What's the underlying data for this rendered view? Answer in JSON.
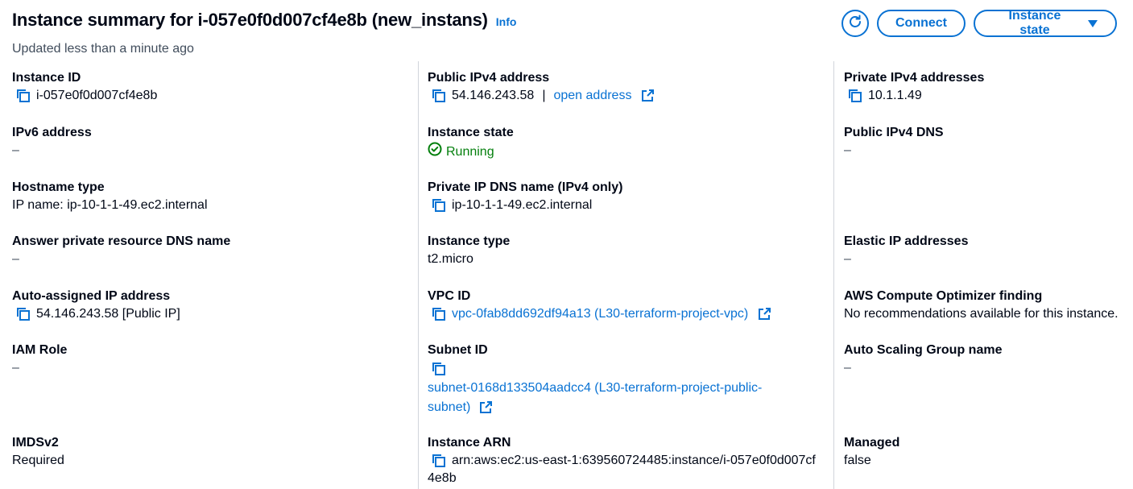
{
  "header": {
    "title": "Instance summary for i-057e0f0d007cf4e8b (new_instans)",
    "info": "Info",
    "subtitle": "Updated less than a minute ago",
    "connect": "Connect",
    "instance_state": "Instance state"
  },
  "col1": {
    "instance_id_label": "Instance ID",
    "instance_id": "i-057e0f0d007cf4e8b",
    "ipv6_label": "IPv6 address",
    "ipv6": "–",
    "hostname_type_label": "Hostname type",
    "hostname_type": "IP name: ip-10-1-1-49.ec2.internal",
    "answer_dns_label": "Answer private resource DNS name",
    "answer_dns": "–",
    "auto_ip_label": "Auto-assigned IP address",
    "auto_ip": "54.146.243.58 [Public IP]",
    "iam_label": "IAM Role",
    "iam": "–",
    "imds_label": "IMDSv2",
    "imds": "Required"
  },
  "col2": {
    "public_ipv4_label": "Public IPv4 address",
    "public_ipv4": "54.146.243.58",
    "separator": "|",
    "open_address": "open address",
    "state_label": "Instance state",
    "state": "Running",
    "private_dns_label": "Private IP DNS name (IPv4 only)",
    "private_dns": "ip-10-1-1-49.ec2.internal",
    "type_label": "Instance type",
    "type": "t2.micro",
    "vpc_label": "VPC ID",
    "vpc": "vpc-0fab8dd692df94a13 (L30-terraform-project-vpc)",
    "subnet_label": "Subnet ID",
    "subnet_line1": "subnet-0168d133504aadcc4 (L30-terraform-project-public-",
    "subnet_line2": "subnet)",
    "arn_label": "Instance ARN",
    "arn_line1": "arn:aws:ec2:us-east-1:639560724485:instance/i-057e0f0d007cf",
    "arn_line2": "4e8b"
  },
  "col3": {
    "private_ipv4_label": "Private IPv4 addresses",
    "private_ipv4": "10.1.1.49",
    "public_dns_label": "Public IPv4 DNS",
    "public_dns": "–",
    "elastic_label": "Elastic IP addresses",
    "elastic": "–",
    "optimizer_label": "AWS Compute Optimizer finding",
    "optimizer": "No recommendations available for this instance.",
    "asg_label": "Auto Scaling Group name",
    "asg": "–",
    "managed_label": "Managed",
    "managed": "false"
  },
  "icons": {
    "refresh": "refresh-icon",
    "copy": "copy-icon",
    "external": "external-link-icon",
    "status": "status-success-icon",
    "caret": "caret-down-icon"
  },
  "colors": {
    "accent": "#0972d3",
    "success": "#037f0c",
    "text": "#000716",
    "muted": "#414d5c"
  }
}
